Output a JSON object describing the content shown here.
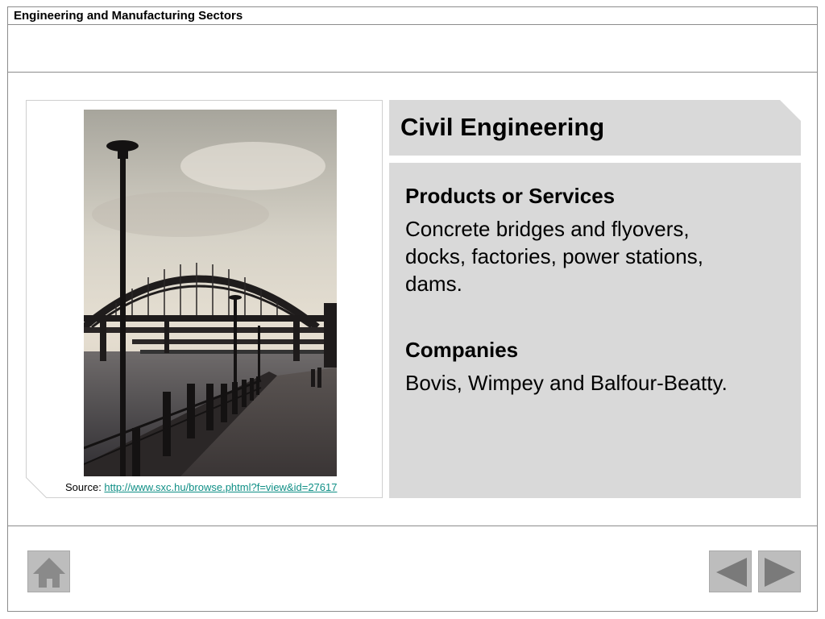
{
  "header": {
    "title": "Engineering and Manufacturing Sectors"
  },
  "slide": {
    "heading": "Civil Engineering",
    "sections": [
      {
        "title": "Products or Services",
        "text": "Concrete bridges and flyovers, docks, factories, power stations, dams."
      },
      {
        "title": "Companies",
        "text": "Bovis, Wimpey and Balfour-Beatty."
      }
    ],
    "image": {
      "subject": "bridge-over-river-photo"
    },
    "source": {
      "label": "Source: ",
      "link": "http://www.sxc.hu/browse.phtml?f=view&id=27617"
    }
  },
  "navigation": {
    "home_icon": "home-icon",
    "prev_icon": "triangle-left-icon",
    "next_icon": "triangle-right-icon"
  },
  "colors": {
    "panel_grey": "#d9d9d9",
    "button_grey": "#bdbdbd",
    "link_teal": "#0f8f86",
    "rule_grey": "#8c8c8c"
  }
}
